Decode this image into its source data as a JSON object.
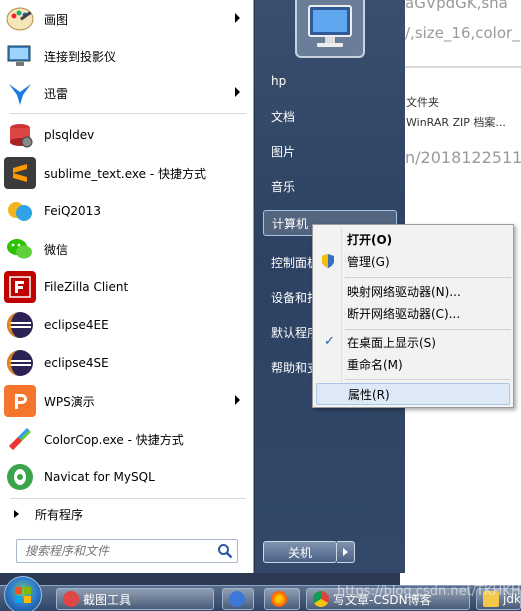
{
  "background_page": {
    "url_top": "aGVpdGK,sha",
    "url_mid": "/,size_16,color_",
    "url_low": "n/2018122511",
    "info_line1": "文件夹",
    "info_line2": "WinRAR ZIP 档案..."
  },
  "start_menu": {
    "programs": [
      {
        "label": "画图",
        "icon": "paint-icon",
        "has_arrow": true
      },
      {
        "label": "连接到投影仪",
        "icon": "projector-icon",
        "has_arrow": false
      },
      {
        "label": "迅雷",
        "icon": "thunder-icon",
        "has_arrow": true
      },
      {
        "label": "plsqldev",
        "icon": "plsqldev-icon",
        "has_arrow": false
      },
      {
        "label": "sublime_text.exe - 快捷方式",
        "icon": "sublime-icon",
        "has_arrow": false
      },
      {
        "label": "FeiQ2013",
        "icon": "feiq-icon",
        "has_arrow": false
      },
      {
        "label": "微信",
        "icon": "wechat-icon",
        "has_arrow": false
      },
      {
        "label": "FileZilla Client",
        "icon": "filezilla-icon",
        "has_arrow": false
      },
      {
        "label": "eclipse4EE",
        "icon": "eclipse-icon",
        "has_arrow": false
      },
      {
        "label": "eclipse4SE",
        "icon": "eclipse-icon",
        "has_arrow": false
      },
      {
        "label": "WPS演示",
        "icon": "wps-icon",
        "has_arrow": true
      },
      {
        "label": "ColorCop.exe - 快捷方式",
        "icon": "colorcop-icon",
        "has_arrow": false
      },
      {
        "label": "Navicat for MySQL",
        "icon": "navicat-icon",
        "has_arrow": false
      }
    ],
    "all_programs": "所有程序",
    "search_placeholder": "搜索程序和文件",
    "right_links": [
      "hp",
      "文档",
      "图片",
      "音乐",
      "计算机",
      "控制面板",
      "设备和打印机",
      "默认程序",
      "帮助和支持"
    ],
    "right_links_visible": [
      "hp",
      "文档",
      "图片",
      "音乐",
      "计算机",
      "控制面板",
      "设备和打",
      "默认程序",
      "帮助和支"
    ],
    "shutdown_label": "关机"
  },
  "context_menu": {
    "items": [
      {
        "label": "打开(O)",
        "bold": true
      },
      {
        "label": "管理(G)",
        "icon": "shield-icon"
      },
      {
        "label": "映射网络驱动器(N)..."
      },
      {
        "label": "断开网络驱动器(C)..."
      },
      {
        "label": "在桌面上显示(S)",
        "checked": true
      },
      {
        "label": "重命名(M)"
      },
      {
        "label": "属性(R)",
        "highlighted": true
      }
    ]
  },
  "taskbar": {
    "buttons": [
      {
        "label": "截图工具",
        "icon": "snipping-tool-icon"
      },
      {
        "label": "",
        "icon": "app-icon"
      },
      {
        "label": "",
        "icon": "firefox-icon"
      },
      {
        "label": "写文章-CSDN博客",
        "icon": "chrome-icon"
      },
      {
        "label": "jdk",
        "icon": "folder-icon"
      }
    ],
    "watermark": "https://blog.csdn.net/TKHKHF"
  },
  "colors": {
    "right_pane": "#2d4262",
    "menu_highlight": "#dde9f7",
    "taskbar": "#2f4465"
  }
}
